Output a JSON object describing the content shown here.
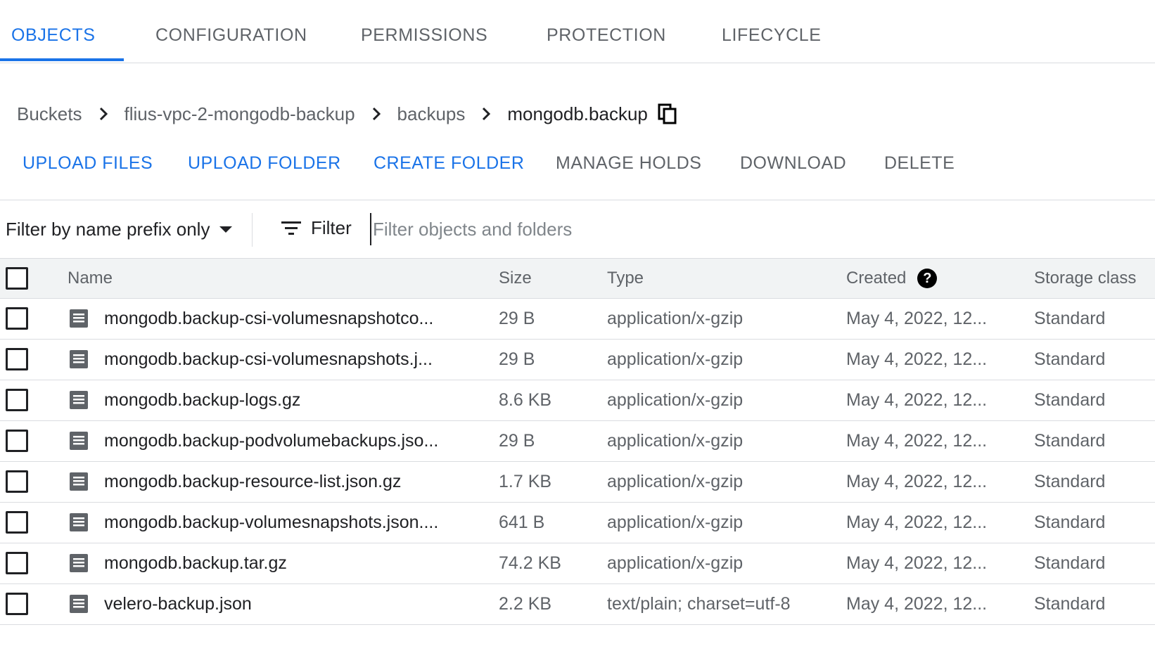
{
  "tabs": [
    {
      "label": "OBJECTS",
      "active": true
    },
    {
      "label": "CONFIGURATION",
      "active": false
    },
    {
      "label": "PERMISSIONS",
      "active": false
    },
    {
      "label": "PROTECTION",
      "active": false
    },
    {
      "label": "LIFECYCLE",
      "active": false
    }
  ],
  "breadcrumb": {
    "items": [
      "Buckets",
      "flius-vpc-2-mongodb-backup",
      "backups",
      "mongodb.backup"
    ],
    "separator_icon": "chevron-right-icon",
    "copy_icon": "copy-icon"
  },
  "actions": {
    "upload_files": "UPLOAD FILES",
    "upload_folder": "UPLOAD FOLDER",
    "create_folder": "CREATE FOLDER",
    "manage_holds": "MANAGE HOLDS",
    "download": "DOWNLOAD",
    "delete": "DELETE"
  },
  "filter": {
    "mode_label": "Filter by name prefix only",
    "button_label": "Filter",
    "placeholder": "Filter objects and folders",
    "value": ""
  },
  "table": {
    "columns": {
      "name": "Name",
      "size": "Size",
      "type": "Type",
      "created": "Created",
      "storage": "Storage class"
    },
    "rows": [
      {
        "name": "mongodb.backup-csi-volumesnapshotco...",
        "size": "29 B",
        "type": "application/x-gzip",
        "created": "May 4, 2022, 12...",
        "storage": "Standard"
      },
      {
        "name": "mongodb.backup-csi-volumesnapshots.j...",
        "size": "29 B",
        "type": "application/x-gzip",
        "created": "May 4, 2022, 12...",
        "storage": "Standard"
      },
      {
        "name": "mongodb.backup-logs.gz",
        "size": "8.6 KB",
        "type": "application/x-gzip",
        "created": "May 4, 2022, 12...",
        "storage": "Standard"
      },
      {
        "name": "mongodb.backup-podvolumebackups.jso...",
        "size": "29 B",
        "type": "application/x-gzip",
        "created": "May 4, 2022, 12...",
        "storage": "Standard"
      },
      {
        "name": "mongodb.backup-resource-list.json.gz",
        "size": "1.7 KB",
        "type": "application/x-gzip",
        "created": "May 4, 2022, 12...",
        "storage": "Standard"
      },
      {
        "name": "mongodb.backup-volumesnapshots.json....",
        "size": "641 B",
        "type": "application/x-gzip",
        "created": "May 4, 2022, 12...",
        "storage": "Standard"
      },
      {
        "name": "mongodb.backup.tar.gz",
        "size": "74.2 KB",
        "type": "application/x-gzip",
        "created": "May 4, 2022, 12...",
        "storage": "Standard"
      },
      {
        "name": "velero-backup.json",
        "size": "2.2 KB",
        "type": "text/plain; charset=utf-8",
        "created": "May 4, 2022, 12...",
        "storage": "Standard"
      }
    ]
  },
  "colors": {
    "accent": "#1a73e8",
    "text": "#202124",
    "muted": "#5f6368",
    "divider": "#dadce0",
    "header_bg": "#f1f3f4"
  }
}
